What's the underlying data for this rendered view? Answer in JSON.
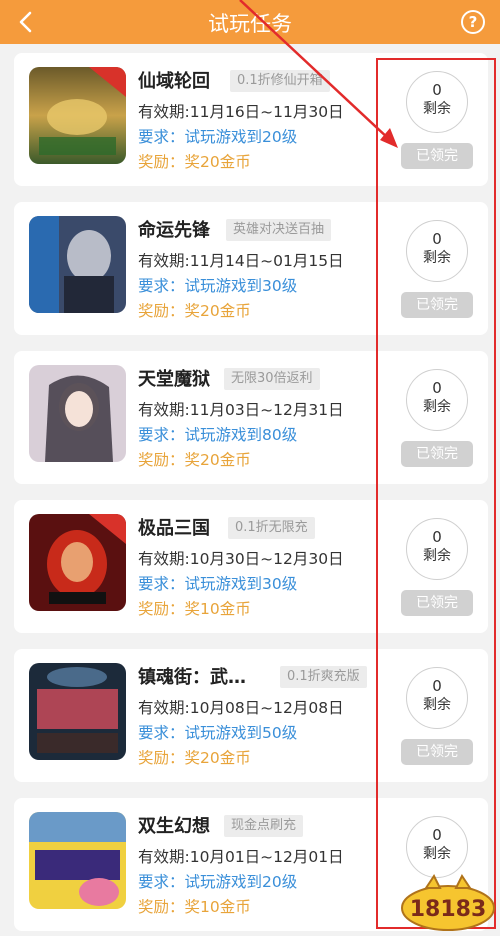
{
  "header": {
    "title": "试玩任务",
    "back_icon": "chevron-left-icon",
    "help_icon": "question-circle-icon",
    "help_glyph": "?"
  },
  "labels": {
    "validity_prefix": "有效期:",
    "req_key": "要求：",
    "reward_key": "奖励：",
    "remain": "剩余",
    "done": "已领完"
  },
  "tasks": [
    {
      "name": "仙域轮回",
      "tag": "0.1折修仙开箱",
      "badge": "0.1折",
      "validity": "11月16日~11月30日",
      "requirement": "试玩游戏到20级",
      "reward": "奖20金币",
      "remaining": "0"
    },
    {
      "name": "命运先锋",
      "tag": "英雄对决送百抽",
      "badge": "",
      "validity": "11月14日~01月15日",
      "requirement": "试玩游戏到30级",
      "reward": "奖20金币",
      "remaining": "0"
    },
    {
      "name": "天堂魔狱",
      "tag": "无限30倍返利",
      "badge": "",
      "validity": "11月03日~12月31日",
      "requirement": "试玩游戏到80级",
      "reward": "奖20金币",
      "remaining": "0"
    },
    {
      "name": "极品三国",
      "tag": "0.1折无限充",
      "badge": "0.1折",
      "validity": "10月30日~12月30日",
      "requirement": "试玩游戏到30级",
      "reward": "奖10金币",
      "remaining": "0"
    },
    {
      "name": "镇魂街：武…",
      "tag": "0.1折爽充版",
      "badge": "",
      "validity": "10月08日~12月08日",
      "requirement": "试玩游戏到50级",
      "reward": "奖20金币",
      "remaining": "0"
    },
    {
      "name": "双生幻想",
      "tag": "现金点刷充",
      "badge": "",
      "validity": "10月01日~12月01日",
      "requirement": "试玩游戏到20级",
      "reward": "奖10金币",
      "remaining": "0"
    }
  ],
  "watermark": {
    "text": "18183"
  },
  "colors": {
    "header": "#f59b3c",
    "blue": "#3a8fd9",
    "gold": "#e8a43a",
    "highlight": "#e22b2b"
  }
}
